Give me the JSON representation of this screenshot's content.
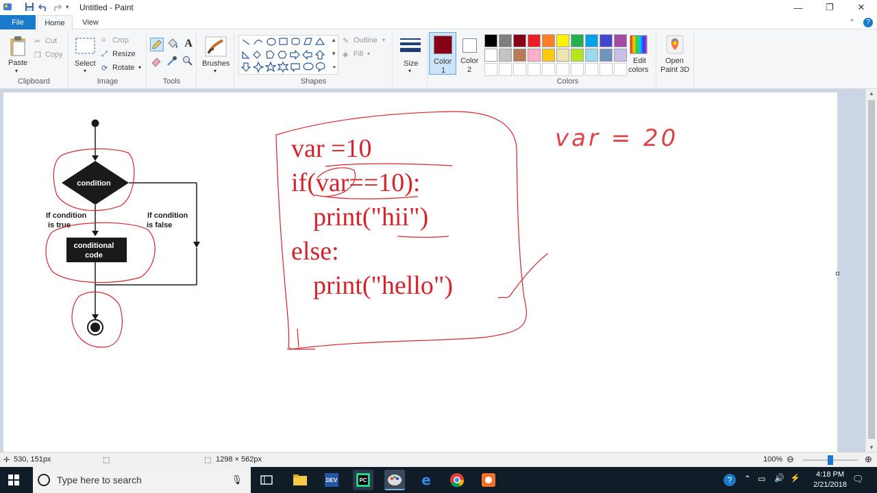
{
  "window": {
    "title": "Untitled - Paint",
    "minimize_glyph": "—",
    "maximize_glyph": "❐",
    "close_glyph": "✕"
  },
  "tabs": {
    "file": "File",
    "home": "Home",
    "view": "View"
  },
  "ribbon": {
    "clipboard": {
      "paste": "Paste",
      "cut": "Cut",
      "copy": "Copy",
      "label": "Clipboard"
    },
    "image": {
      "select": "Select",
      "crop": "Crop",
      "resize": "Resize",
      "rotate": "Rotate",
      "label": "Image"
    },
    "tools": {
      "label": "Tools"
    },
    "brushes": {
      "label": "Brushes"
    },
    "shapes": {
      "outline": "Outline",
      "fill": "Fill",
      "label": "Shapes"
    },
    "size": {
      "label": "Size"
    },
    "color1": {
      "line1": "Color",
      "line2": "1"
    },
    "color2": {
      "line1": "Color",
      "line2": "2"
    },
    "colors": {
      "label": "Colors",
      "edit_line1": "Edit",
      "edit_line2": "colors",
      "palette_row1": [
        "#000000",
        "#7f7f7f",
        "#880015",
        "#ed1c24",
        "#ff7f27",
        "#fff200",
        "#22b14c",
        "#00a2e8",
        "#3f48cc",
        "#a349a4"
      ],
      "palette_row2": [
        "#ffffff",
        "#c3c3c3",
        "#b97a57",
        "#ffaec9",
        "#ffc90e",
        "#efe4b0",
        "#b5e61d",
        "#99d9ea",
        "#7092be",
        "#c8bfe7"
      ],
      "color1_value": "#880015",
      "color2_value": "#ffffff"
    },
    "paint3d": {
      "line1": "Open",
      "line2": "Paint 3D"
    }
  },
  "canvas": {
    "flowchart": {
      "condition": "condition",
      "true_line1": "If condition",
      "true_line2": "is true",
      "false_line1": "If condition",
      "false_line2": "is false",
      "code_line1": "conditional",
      "code_line2": "code"
    },
    "code": {
      "line1": "var =10",
      "line2": "if(var==10):",
      "line3": "print(\"hii\")",
      "line4": "else:",
      "line5": "print(\"hello\")"
    },
    "handwritten": "var = 20",
    "ink_color": "#d8222b"
  },
  "status": {
    "cursor_pos": "530, 151px",
    "canvas_size": "1298 × 562px",
    "zoom": "100%"
  },
  "taskbar": {
    "search_placeholder": "Type here to search",
    "time": "4:18 PM",
    "date": "2/21/2018"
  }
}
